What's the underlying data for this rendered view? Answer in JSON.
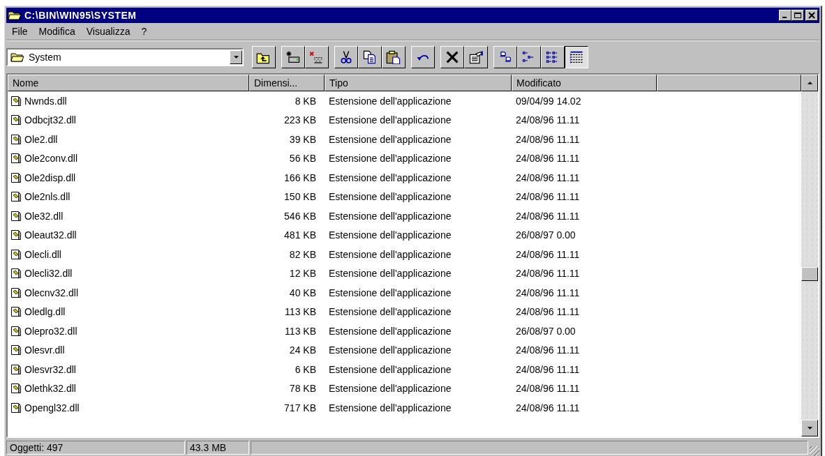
{
  "window": {
    "title": "C:\\BIN\\WIN95\\SYSTEM"
  },
  "menu": [
    "File",
    "Modifica",
    "Visualizza",
    "?"
  ],
  "address": {
    "value": "System"
  },
  "toolbar": [
    {
      "kind": "up",
      "selected": false
    },
    {
      "kind": "map",
      "selected": false
    },
    {
      "kind": "disconnect",
      "selected": false
    },
    {
      "kind": "cut",
      "selected": false
    },
    {
      "kind": "copy",
      "selected": false
    },
    {
      "kind": "paste",
      "selected": false
    },
    {
      "kind": "undo",
      "selected": false
    },
    {
      "kind": "delete",
      "selected": false
    },
    {
      "kind": "properties",
      "selected": false
    },
    {
      "kind": "large",
      "selected": false
    },
    {
      "kind": "small",
      "selected": false
    },
    {
      "kind": "list",
      "selected": false
    },
    {
      "kind": "details",
      "selected": true
    }
  ],
  "table": {
    "columns": [
      "Nome",
      "Dimensi...",
      "Tipo",
      "Modificato"
    ],
    "rows": [
      [
        "Nwnds.dll",
        "8 KB",
        "Estensione dell'applicazione",
        "09/04/99 14.02"
      ],
      [
        "Odbcjt32.dll",
        "223 KB",
        "Estensione dell'applicazione",
        "24/08/96 11.11"
      ],
      [
        "Ole2.dll",
        "39 KB",
        "Estensione dell'applicazione",
        "24/08/96 11.11"
      ],
      [
        "Ole2conv.dll",
        "56 KB",
        "Estensione dell'applicazione",
        "24/08/96 11.11"
      ],
      [
        "Ole2disp.dll",
        "166 KB",
        "Estensione dell'applicazione",
        "24/08/96 11.11"
      ],
      [
        "Ole2nls.dll",
        "150 KB",
        "Estensione dell'applicazione",
        "24/08/96 11.11"
      ],
      [
        "Ole32.dll",
        "546 KB",
        "Estensione dell'applicazione",
        "24/08/96 11.11"
      ],
      [
        "Oleaut32.dll",
        "481 KB",
        "Estensione dell'applicazione",
        "26/08/97 0.00"
      ],
      [
        "Olecli.dll",
        "82 KB",
        "Estensione dell'applicazione",
        "24/08/96 11.11"
      ],
      [
        "Olecli32.dll",
        "12 KB",
        "Estensione dell'applicazione",
        "24/08/96 11.11"
      ],
      [
        "Olecnv32.dll",
        "40 KB",
        "Estensione dell'applicazione",
        "24/08/96 11.11"
      ],
      [
        "Oledlg.dll",
        "113 KB",
        "Estensione dell'applicazione",
        "24/08/96 11.11"
      ],
      [
        "Olepro32.dll",
        "113 KB",
        "Estensione dell'applicazione",
        "26/08/97 0.00"
      ],
      [
        "Olesvr.dll",
        "24 KB",
        "Estensione dell'applicazione",
        "24/08/96 11.11"
      ],
      [
        "Olesvr32.dll",
        "6 KB",
        "Estensione dell'applicazione",
        "24/08/96 11.11"
      ],
      [
        "Olethk32.dll",
        "78 KB",
        "Estensione dell'applicazione",
        "24/08/96 11.11"
      ],
      [
        "Opengl32.dll",
        "717 KB",
        "Estensione dell'applicazione",
        "24/08/96 11.11"
      ]
    ]
  },
  "status_bar": [
    "Oggetti: 497",
    "43.3 MB"
  ]
}
